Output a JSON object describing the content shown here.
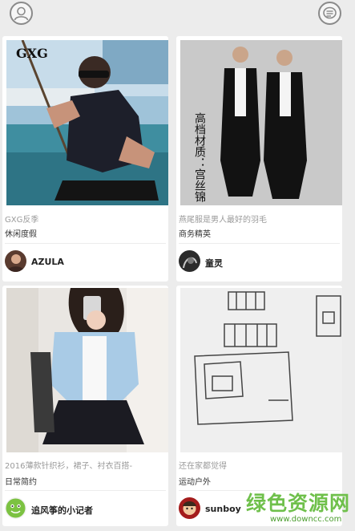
{
  "header": {
    "left_icon": "user-icon",
    "right_icon": "message-icon"
  },
  "cards": [
    {
      "photo_text": "GXG",
      "subtitle": "GXG反季",
      "title": "休闲度假",
      "user": "AZULA"
    },
    {
      "photo_text": "高档材质：宫丝锦",
      "subtitle": "燕尾服是男人最好的羽毛",
      "title": "商务精英",
      "user": "童灵"
    },
    {
      "subtitle": "2016薄款针织衫，裙子、衬衣百搭-",
      "title": "日常简约",
      "user": "追风筝的小记者"
    },
    {
      "subtitle": "还在家都觉得",
      "title": "运动户外",
      "user": "sunboy"
    }
  ],
  "watermark": {
    "main": "绿色资源网",
    "url": "www.downcc.com"
  },
  "colors": {
    "background": "#ececec",
    "card": "#ffffff",
    "watermark_green": "#6fc04b"
  }
}
